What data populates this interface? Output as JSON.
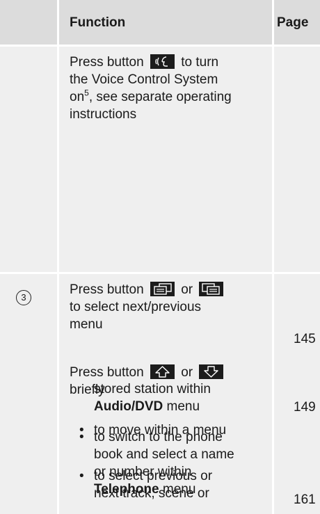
{
  "header": {
    "function": "Function",
    "page": "Page"
  },
  "row1": {
    "line1_a": "Press button",
    "line1_b": "to turn",
    "line2": "the Voice Control System",
    "line3_a": "on",
    "line3_sup": "5",
    "line3_b": ", see separate operating",
    "line4": "instructions"
  },
  "row2": {
    "marker": "3",
    "p1_line1_a": "Press button",
    "p1_line1_or": "or",
    "p1_line2": "to select next/previous",
    "p1_line3": "menu",
    "p1_page": "145",
    "p2_line1_a": "Press button",
    "p2_line1_or": "or",
    "p2_line2": "briefly",
    "bullets": [
      {
        "lines": [
          "to move within a menu"
        ]
      },
      {
        "lines": [
          "to select previous or",
          "next track, scene or",
          "stored station within"
        ],
        "bold": "Audio/DVD",
        "tail": " menu",
        "page": "149"
      },
      {
        "lines": [
          "to switch to the phone",
          "book and select a name",
          "or number within"
        ],
        "bold": "Telephone",
        "tail": " menu",
        "page": "161"
      }
    ],
    "bullet_char": "•"
  },
  "icons": [
    "voice-control-icon",
    "menu-next-icon",
    "menu-prev-icon",
    "arrow-up-icon",
    "arrow-down-icon"
  ]
}
